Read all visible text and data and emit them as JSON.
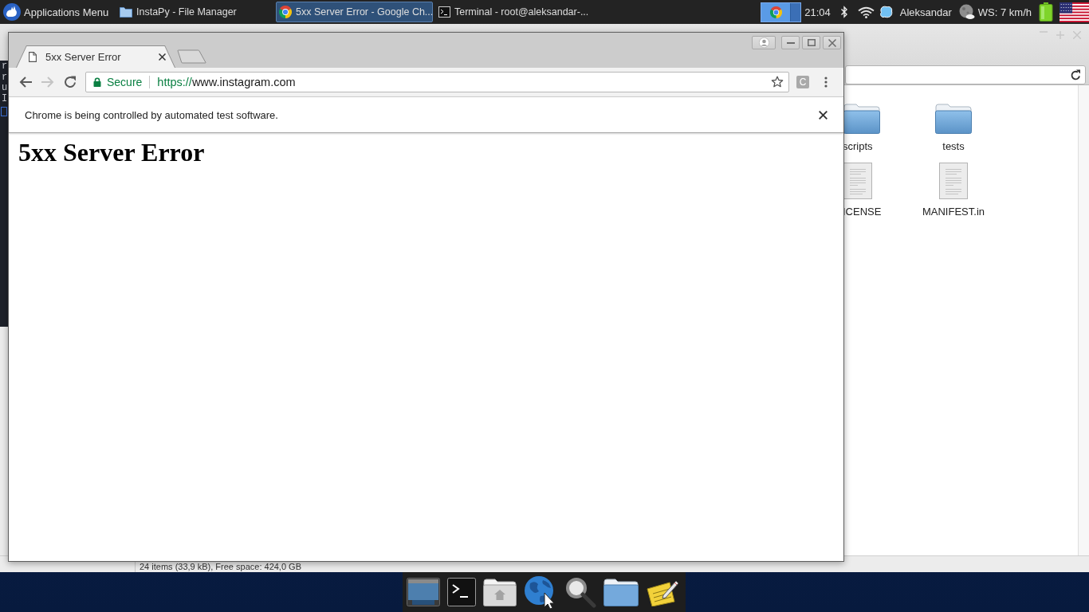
{
  "panel": {
    "app_menu": "Applications Menu",
    "tasks": [
      {
        "kind": "folder",
        "label": "InstaPy - File Manager",
        "selected": false
      },
      {
        "kind": "browser",
        "label": "5xx Server Error - Google Ch...",
        "selected": true
      },
      {
        "kind": "terminal",
        "label": "Terminal - root@aleksandar-...",
        "selected": false
      }
    ],
    "clock": "21:04",
    "user": "Aleksandar",
    "weather": "WS: 7 km/h"
  },
  "browser": {
    "tabs": [
      {
        "title": "5xx Server Error",
        "selected": true
      }
    ],
    "toolbar_buttons": [
      {
        "kind": "back",
        "disabled": false
      },
      {
        "kind": "forward",
        "disabled": true
      },
      {
        "kind": "reload",
        "disabled": false
      }
    ],
    "address_bar": {
      "security": "Secure",
      "scheme": "https://",
      "host": "www.instagram.com"
    },
    "extension": "C",
    "infobar": "Chrome is being controlled by automated test software.",
    "page_heading": "5xx Server Error"
  },
  "terminal": {
    "lines": [
      "r",
      "r",
      "u",
      "I"
    ]
  },
  "file_manager": {
    "items": [
      {
        "kind": "folder",
        "name": "scripts"
      },
      {
        "kind": "folder",
        "name": "tests"
      },
      {
        "kind": "file",
        "name": "ICENSE"
      },
      {
        "kind": "file",
        "name": "MANIFEST.in"
      }
    ],
    "status_bar": "24 items (33,9 kB), Free space: 424,0 GB"
  }
}
